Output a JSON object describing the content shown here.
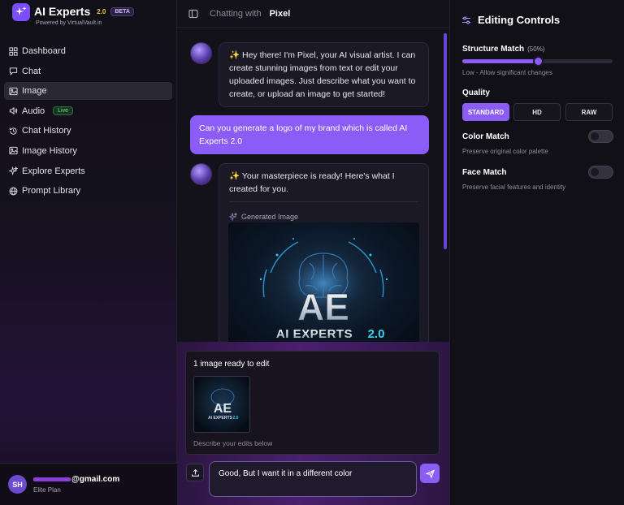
{
  "brand": {
    "name": "AI Experts",
    "version": "2.0",
    "badge": "BETA",
    "tagline": "Powered by VirtualVault.in"
  },
  "nav": {
    "items": [
      {
        "label": "Dashboard",
        "icon": "dashboard-icon"
      },
      {
        "label": "Chat",
        "icon": "chat-icon"
      },
      {
        "label": "Image",
        "icon": "image-icon",
        "active": true
      },
      {
        "label": "Audio",
        "icon": "audio-icon",
        "badge": "Live"
      },
      {
        "label": "Chat History",
        "icon": "history-icon"
      },
      {
        "label": "Image History",
        "icon": "image-history-icon"
      },
      {
        "label": "Explore Experts",
        "icon": "sparkles-icon"
      },
      {
        "label": "Prompt Library",
        "icon": "globe-icon"
      }
    ]
  },
  "user": {
    "initials": "SH",
    "email": "@gmail.com",
    "plan": "Elite Plan"
  },
  "chat": {
    "header_prefix": "Chatting with",
    "agent_name": "Pixel",
    "messages": [
      {
        "role": "assistant",
        "text": "✨ Hey there! I'm Pixel, your AI visual artist. I can create stunning images from text or edit your uploaded images. Just describe what you want to create, or upload an image to get started!"
      },
      {
        "role": "user",
        "text": "Can you generate a logo of my brand which is called AI Experts 2.0"
      },
      {
        "role": "assistant",
        "text": "✨ Your masterpiece is ready! Here's what I created for you.",
        "attachment_label": "Generated Image"
      }
    ],
    "image_art": {
      "monogram": "AE",
      "wordmark": "AI EXPERTS",
      "wordmark_version": "2.0"
    }
  },
  "edit": {
    "title": "1 image ready to edit",
    "hint": "Describe your edits below",
    "input_value": "Good, But I want it in a different color"
  },
  "panel": {
    "title": "Editing Controls",
    "structure": {
      "label": "Structure Match",
      "value_text": "(50%)",
      "value": 0.5,
      "desc": "Low - Allow significant changes"
    },
    "quality": {
      "label": "Quality",
      "options": [
        "STANDARD",
        "HD",
        "RAW"
      ],
      "selected": "STANDARD"
    },
    "color_match": {
      "label": "Color Match",
      "desc": "Preserve original color palette",
      "enabled": false
    },
    "face_match": {
      "label": "Face Match",
      "desc": "Preserve facial features and identity",
      "enabled": false
    }
  },
  "colors": {
    "accent": "#8b5cf6",
    "background": "#13111a",
    "live": "#7bd88f"
  }
}
